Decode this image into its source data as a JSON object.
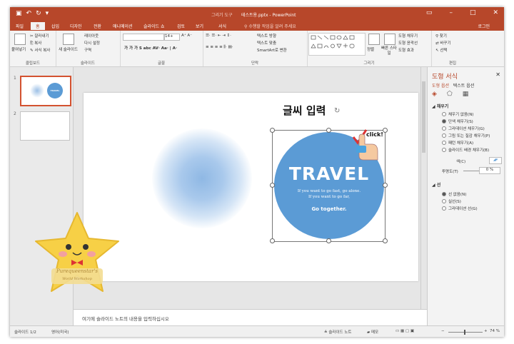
{
  "app": {
    "context_tab_label": "그리기 도구",
    "title": "테스트용.pptx - PowerPoint",
    "login": "로그인"
  },
  "tabs": [
    "파일",
    "홈",
    "삽입",
    "디자인",
    "전환",
    "애니메이션",
    "슬라이드 쇼",
    "검토",
    "보기",
    "서식"
  ],
  "tell_me": "수행할 작업을 알려 주세요",
  "ribbon": {
    "clipboard": {
      "paste": "붙여넣기",
      "cut": "잘라내기",
      "copy": "복사",
      "format_painter": "서식 복사",
      "label": "클립보드"
    },
    "slides": {
      "new_slide": "새 슬라이드",
      "layout": "레이아웃",
      "reset": "다시 설정",
      "section": "구역",
      "label": "슬라이드"
    },
    "font": {
      "font_name": "",
      "font_size": "14+",
      "label": "글꼴"
    },
    "paragraph": {
      "text_direction": "텍스트 방향",
      "align_text": "텍스트 맞춤",
      "smartart": "SmartArt로 변환",
      "label": "단락"
    },
    "drawing": {
      "arrange": "정렬",
      "quick_styles": "빠른 스타일",
      "shape_fill": "도형 채우기",
      "shape_outline": "도형 윤곽선",
      "shape_effects": "도형 효과",
      "label": "그리기"
    },
    "editing": {
      "find": "찾기",
      "replace": "바꾸기",
      "select": "선택",
      "label": "편집"
    }
  },
  "thumbnails": [
    {
      "num": "1",
      "word": "TRAVEL"
    },
    {
      "num": "2"
    }
  ],
  "slide": {
    "text_box": "글씨 입력",
    "travel_title": "TRAVEL",
    "line1": "If you want to go fast, go alone.",
    "line2": "If you want to go far,",
    "line3": "Go together.",
    "click_label": "click!"
  },
  "notes_placeholder": "여기에 슬라이드 노트의 내용을 입력하십시오",
  "format_pane": {
    "title": "도형 서식",
    "tab_shape": "도형 옵션",
    "tab_text": "텍스트 옵션",
    "fill_section": "채우기",
    "fill_options": [
      "채우기 없음(N)",
      "단색 채우기(S)",
      "그라데이션 채우기(G)",
      "그림 또는 질감 채우기(P)",
      "패턴 채우기(A)",
      "슬라이드 배경 채우기(B)"
    ],
    "color_label": "색(C)",
    "transparency_label": "투명도(T)",
    "transparency_value": "0 %",
    "line_section": "선",
    "line_options": [
      "선 없음(N)",
      "실선(S)",
      "그라데이션 선(G)"
    ],
    "selected_fill": 1,
    "selected_line": 0
  },
  "status": {
    "slide_count": "슬라이드 1/2",
    "language": "영어(미국)",
    "notes": "슬라이드 노트",
    "comments": "메모",
    "zoom": "74 %"
  },
  "watermark": {
    "line1": "Purequeenstar's",
    "line2": "World Workshop"
  },
  "colors": {
    "accent": "#b7472a",
    "circle": "#5b9bd5",
    "star": "#f7d046"
  }
}
